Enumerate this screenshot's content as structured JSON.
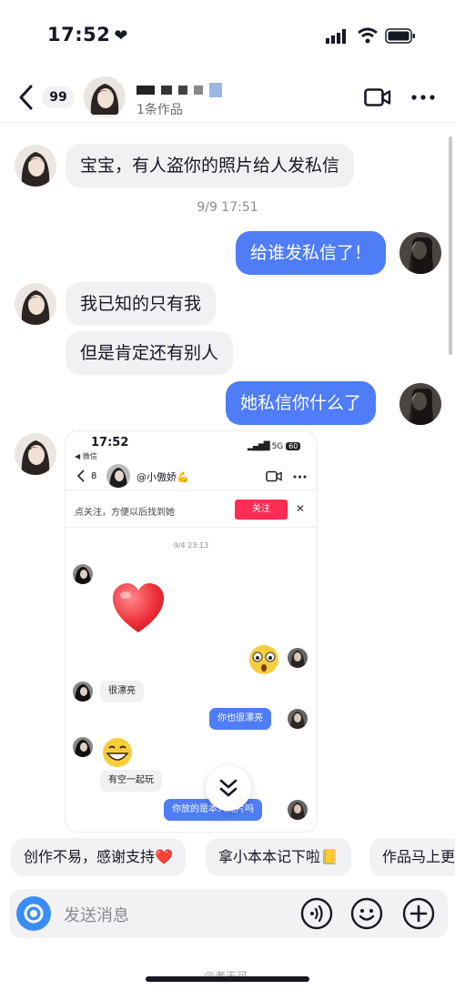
{
  "status_bar": {
    "time": "17:52"
  },
  "header": {
    "badge": "99",
    "works": "1条作品"
  },
  "chat": {
    "msg1": "宝宝，有人盗你的照片给人发私信",
    "timestamp": "9/9 17:51",
    "msg2": "给谁发私信了！",
    "msg3": "我已知的只有我",
    "msg4": "但是肯定还有别人",
    "msg5": "她私信你什么了"
  },
  "shared_screenshot": {
    "time": "17:52",
    "back_app": "◀ 微信",
    "network": "5G",
    "battery": "60",
    "count": "8",
    "name": "@小傲娇💪",
    "notice": "点关注，方便以后找到她",
    "follow_label": "关注",
    "timestamp": "9/4 23:13",
    "msg_recv1": "很漂亮",
    "msg_sent1": "你也很漂亮",
    "msg_recv2": "有空一起玩",
    "msg_sent2": "你放的是本人照片吗"
  },
  "quick_replies": [
    "创作不易，感谢支持❤️",
    "拿小本本记下啦📒",
    "作品马上更"
  ],
  "input": {
    "placeholder": "发送消息"
  },
  "watermark": "@老天可"
}
